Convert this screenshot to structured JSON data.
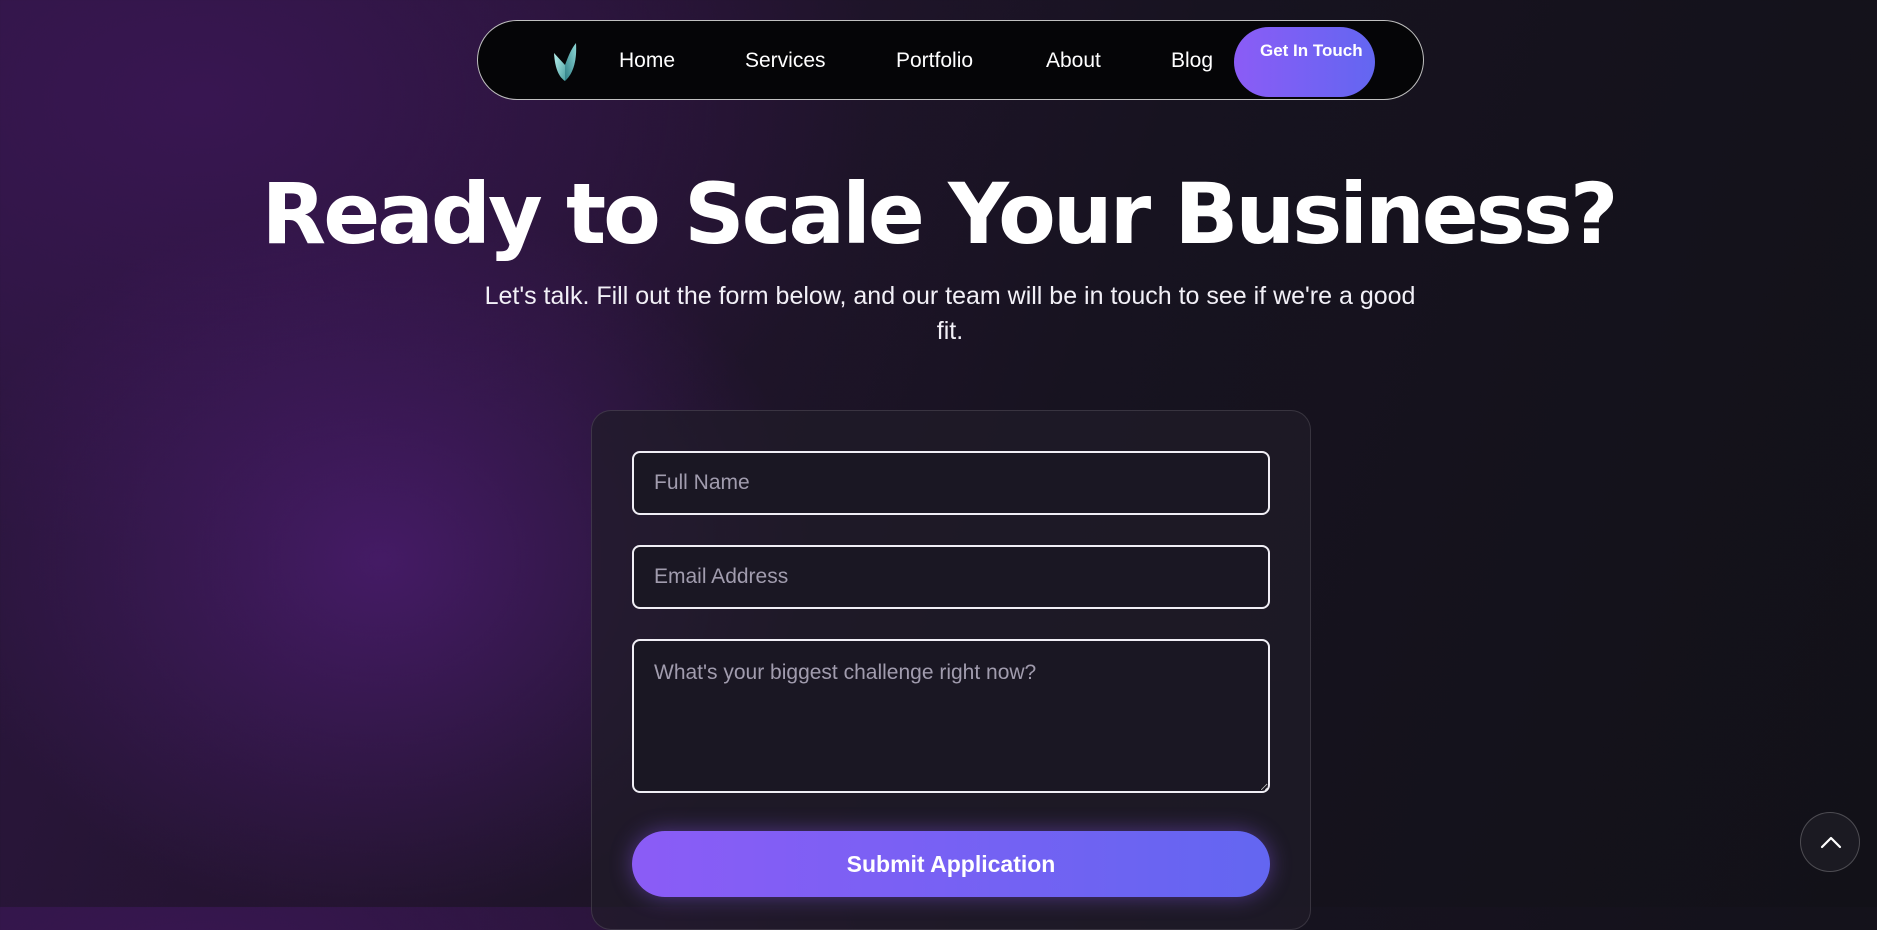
{
  "nav": {
    "links": [
      {
        "label": "Home"
      },
      {
        "label": "Services"
      },
      {
        "label": "Portfolio"
      },
      {
        "label": "About"
      },
      {
        "label": "Blog"
      }
    ],
    "cta_label": "Get In Touch",
    "logo_icon": "leaf-logo-icon"
  },
  "hero": {
    "title": "Ready to Scale Your Business?",
    "subtitle": "Let's talk. Fill out the form below, and our team will be in touch to see if we're a good fit."
  },
  "form": {
    "name_placeholder": "Full Name",
    "name_value": "",
    "email_placeholder": "Email Address",
    "email_value": "",
    "message_placeholder": "What's your biggest challenge right now?",
    "message_value": "",
    "submit_label": "Submit Application"
  },
  "scroll_top": {
    "icon": "chevron-up-icon"
  },
  "colors": {
    "accent_start": "#8b5cf6",
    "accent_end": "#6366f1",
    "background_dark": "#121019",
    "background_purple": "#3a1654"
  }
}
